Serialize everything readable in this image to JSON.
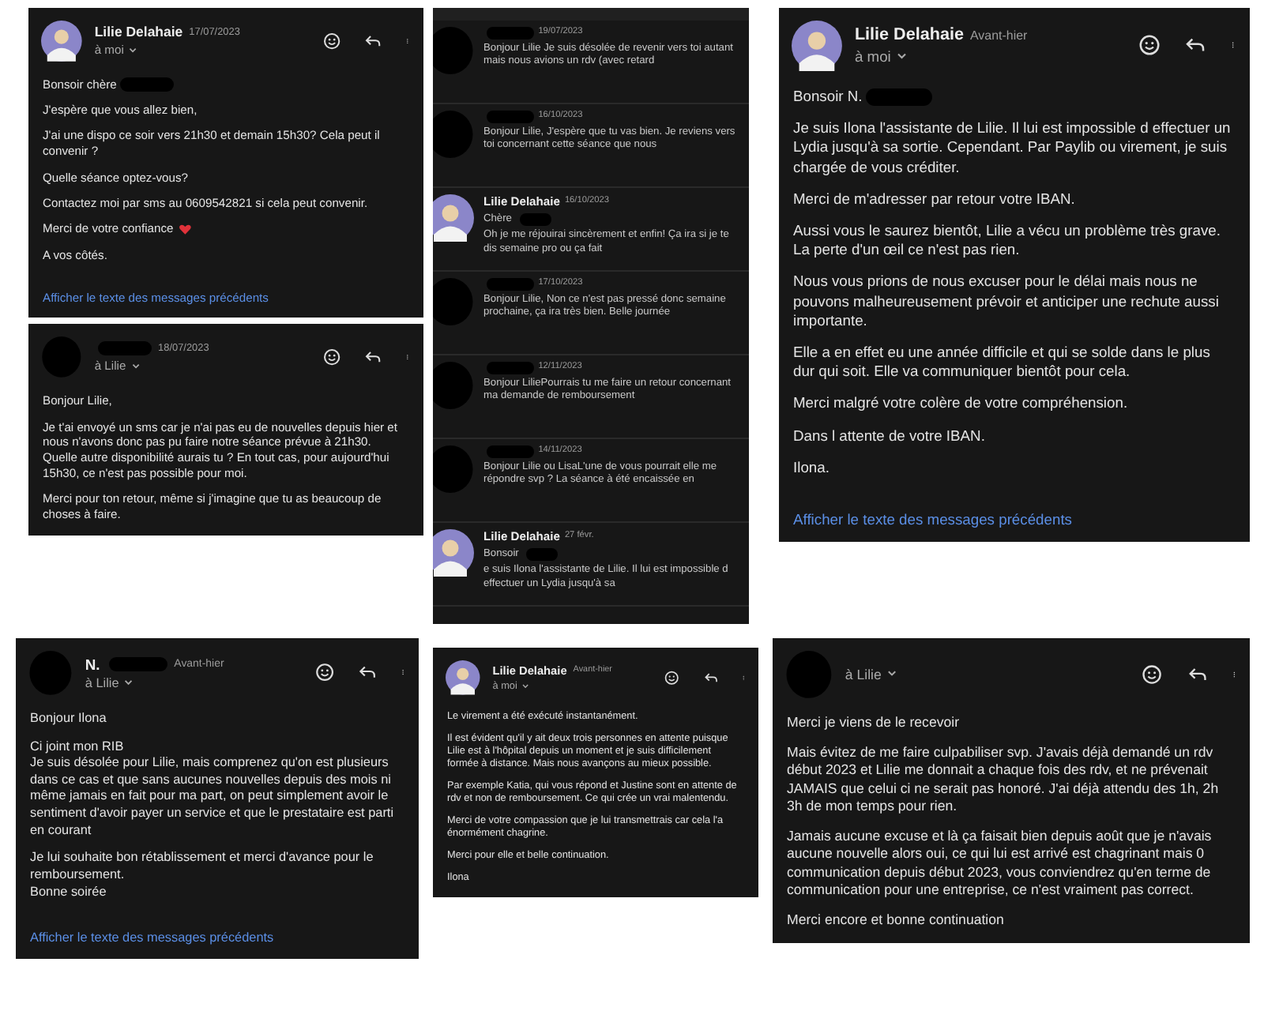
{
  "panels": [
    {
      "kind": "email",
      "header": {
        "avatar": {
          "kind": "photo"
        },
        "sender": "Lilie Delahaie",
        "sender_redacted": false,
        "date": "17/07/2023",
        "recipient": "à moi"
      },
      "paragraphs": [
        {
          "lines": [
            "Bonsoir chère"
          ],
          "redacted": true
        },
        {
          "lines": [
            "J'espère que vous allez bien,"
          ]
        },
        {
          "lines": [
            "J'ai une dispo ce soir vers 21h30 et demain 15h30? Cela peut il convenir ?"
          ]
        },
        {
          "lines": [
            "Quelle séance optez-vous?"
          ]
        },
        {
          "lines": [
            "Contactez moi par sms au 0609542821 si cela peut convenir."
          ]
        },
        {
          "lines": [
            "Merci de votre confiance"
          ],
          "kind": "heart"
        },
        {
          "lines": [
            "A vos côtés."
          ]
        }
      ],
      "link": "Afficher le texte des messages précédents"
    },
    {
      "kind": "email",
      "header": {
        "avatar": {
          "kind": "redacted"
        },
        "sender_redacted": true,
        "date": "18/07/2023",
        "recipient": "à Lilie"
      },
      "paragraphs": [
        {
          "lines": [
            "Bonjour Lilie,"
          ]
        },
        {
          "lines": [
            "Je t'ai envoyé un sms car je n'ai pas eu de nouvelles depuis hier et nous n'avons donc pas pu faire notre séance prévue à 21h30.",
            "Quelle autre disponibilité aurais tu ? En tout cas, pour aujourd'hui 15h30, ce n'est pas possible pour moi."
          ]
        },
        {
          "lines": [
            "Merci pour ton retour, même si j'imagine que tu as beaucoup de choses à faire."
          ]
        }
      ]
    },
    {
      "kind": "thread",
      "items": [
        {
          "avatar": {
            "kind": "redacted"
          },
          "date": "19/07/2023",
          "snippet": "Bonjour Lilie Je suis désolée de revenir vers toi autant mais nous avions un rdv (avec retard"
        },
        {
          "avatar": {
            "kind": "redacted"
          },
          "date": "16/10/2023",
          "snippet": "Bonjour Lilie, J'espère que tu vas bien. Je reviens vers toi concernant cette séance que nous"
        },
        {
          "avatar": {
            "kind": "photo"
          },
          "sender": "Lilie Delahaie",
          "date": "16/10/2023",
          "lead": "Chère",
          "snippet": "Oh je me réjouirai sincèrement et enfin! Ça ira si je te dis semaine pro ou ça fait"
        },
        {
          "avatar": {
            "kind": "redacted"
          },
          "date": "17/10/2023",
          "snippet": "Bonjour Lilie, Non ce n'est pas pressé donc semaine prochaine, ça ira très bien. Belle journée"
        },
        {
          "avatar": {
            "kind": "redacted"
          },
          "date": "12/11/2023",
          "snippet": "Bonjour LiliePourrais tu me faire un retour concernant ma demande de remboursement"
        },
        {
          "avatar": {
            "kind": "redacted"
          },
          "date": "14/11/2023",
          "snippet": "Bonjour Lilie ou LisaL'une de vous pourrait elle me répondre svp ? La séance à été encaissée en"
        },
        {
          "avatar": {
            "kind": "photo"
          },
          "sender": "Lilie Delahaie",
          "date": "27 févr.",
          "lead": "Bonsoir",
          "snippet": "e suis Ilona l'assistante de Lilie. Il lui est impossible d effectuer un Lydia jusqu'à sa"
        }
      ]
    },
    {
      "kind": "email",
      "header": {
        "avatar": {
          "kind": "photo"
        },
        "sender": "Lilie Delahaie",
        "sender_redacted": false,
        "date": "Avant-hier",
        "recipient": "à moi"
      },
      "paragraphs": [
        {
          "lines": [
            "Bonsoir N."
          ],
          "redacted": true
        },
        {
          "lines": [
            "Je suis Ilona l'assistante de Lilie. Il lui est impossible d effectuer un Lydia jusqu'à sa sortie. Cependant. Par Paylib ou virement, je suis chargée de vous créditer."
          ]
        },
        {
          "lines": [
            "Merci de m'adresser par retour votre IBAN."
          ]
        },
        {
          "lines": [
            "Aussi vous le saurez bientôt, Lilie a vécu un problème très grave. La perte d'un œil ce n'est pas rien."
          ]
        },
        {
          "lines": [
            "Nous vous prions de nous excuser pour le délai mais nous ne pouvons malheureusement prévoir et anticiper une rechute aussi importante."
          ]
        },
        {
          "lines": [
            "Elle a en effet eu une année difficile et qui se solde dans le plus dur qui soit. Elle va communiquer bientôt pour cela."
          ]
        },
        {
          "lines": [
            "Merci malgré votre colère de votre compréhension."
          ]
        },
        {
          "lines": [
            "Dans l attente de votre IBAN."
          ]
        },
        {
          "lines": [
            "Ilona."
          ]
        }
      ],
      "link": "Afficher le texte des messages précédents"
    },
    {
      "kind": "email",
      "header": {
        "avatar": {
          "kind": "redacted"
        },
        "sender": "N.",
        "sender_redacted": true,
        "date": "Avant-hier",
        "recipient": "à Lilie"
      },
      "paragraphs": [
        {
          "lines": [
            "Bonjour Ilona"
          ]
        },
        {
          "lines": [
            "Ci joint mon RIB",
            "Je suis désolée pour Lilie, mais comprenez qu'on est plusieurs dans ce cas et que sans aucunes nouvelles depuis des mois ni même jamais en fait pour ma part, on peut simplement avoir le sentiment d'avoir payer un service et que le prestataire est parti en courant"
          ]
        },
        {
          "lines": [
            "Je lui souhaite bon rétablissement et merci d'avance pour le remboursement.",
            "Bonne soirée"
          ]
        }
      ],
      "link": "Afficher le texte des messages précédents"
    },
    {
      "kind": "email",
      "header": {
        "avatar": {
          "kind": "photo"
        },
        "sender": "Lilie Delahaie",
        "sender_redacted": false,
        "date": "Avant-hier",
        "recipient": "à moi"
      },
      "paragraphs": [
        {
          "lines": [
            "Le virement a été exécuté instantanément."
          ]
        },
        {
          "lines": [
            "Il est évident qu'il y ait deux trois personnes en attente puisque Lilie est à l'hôpital depuis un moment et je suis difficilement formée à distance. Mais nous avançons au mieux possible."
          ]
        },
        {
          "lines": [
            "Par exemple Katia, qui vous répond et Justine sont en attente de rdv et non de remboursement. Ce qui crée un vrai malentendu."
          ]
        },
        {
          "lines": [
            "Merci de votre compassion que je lui transmettrais car cela l'a énormément chagrine."
          ]
        },
        {
          "lines": [
            "Merci pour elle et belle continuation."
          ]
        },
        {
          "lines": [
            "Ilona"
          ]
        }
      ]
    },
    {
      "kind": "email",
      "header": {
        "avatar": {
          "kind": "redacted"
        },
        "sender_redacted": false,
        "recipient": "à Lilie"
      },
      "paragraphs": [
        {
          "lines": [
            "Merci je viens de le recevoir"
          ]
        },
        {
          "lines": [
            "Mais évitez de me faire culpabiliser svp. J'avais déjà demandé un rdv début 2023 et Lilie me donnait a chaque fois des rdv, et ne prévenait JAMAIS que celui ci ne serait pas honoré. J'ai déjà attendu des 1h, 2h 3h de mon temps pour rien."
          ]
        },
        {
          "lines": [
            "Jamais aucune excuse et là ça faisait bien depuis août que je n'avais aucune nouvelle alors oui, ce qui lui est arrivé est chagrinant mais 0 communication depuis début 2023, vous conviendrez qu'en terme de communication pour une entreprise, ce n'est vraiment pas correct."
          ]
        },
        {
          "lines": [
            "Merci encore et bonne continuation"
          ]
        }
      ]
    }
  ]
}
